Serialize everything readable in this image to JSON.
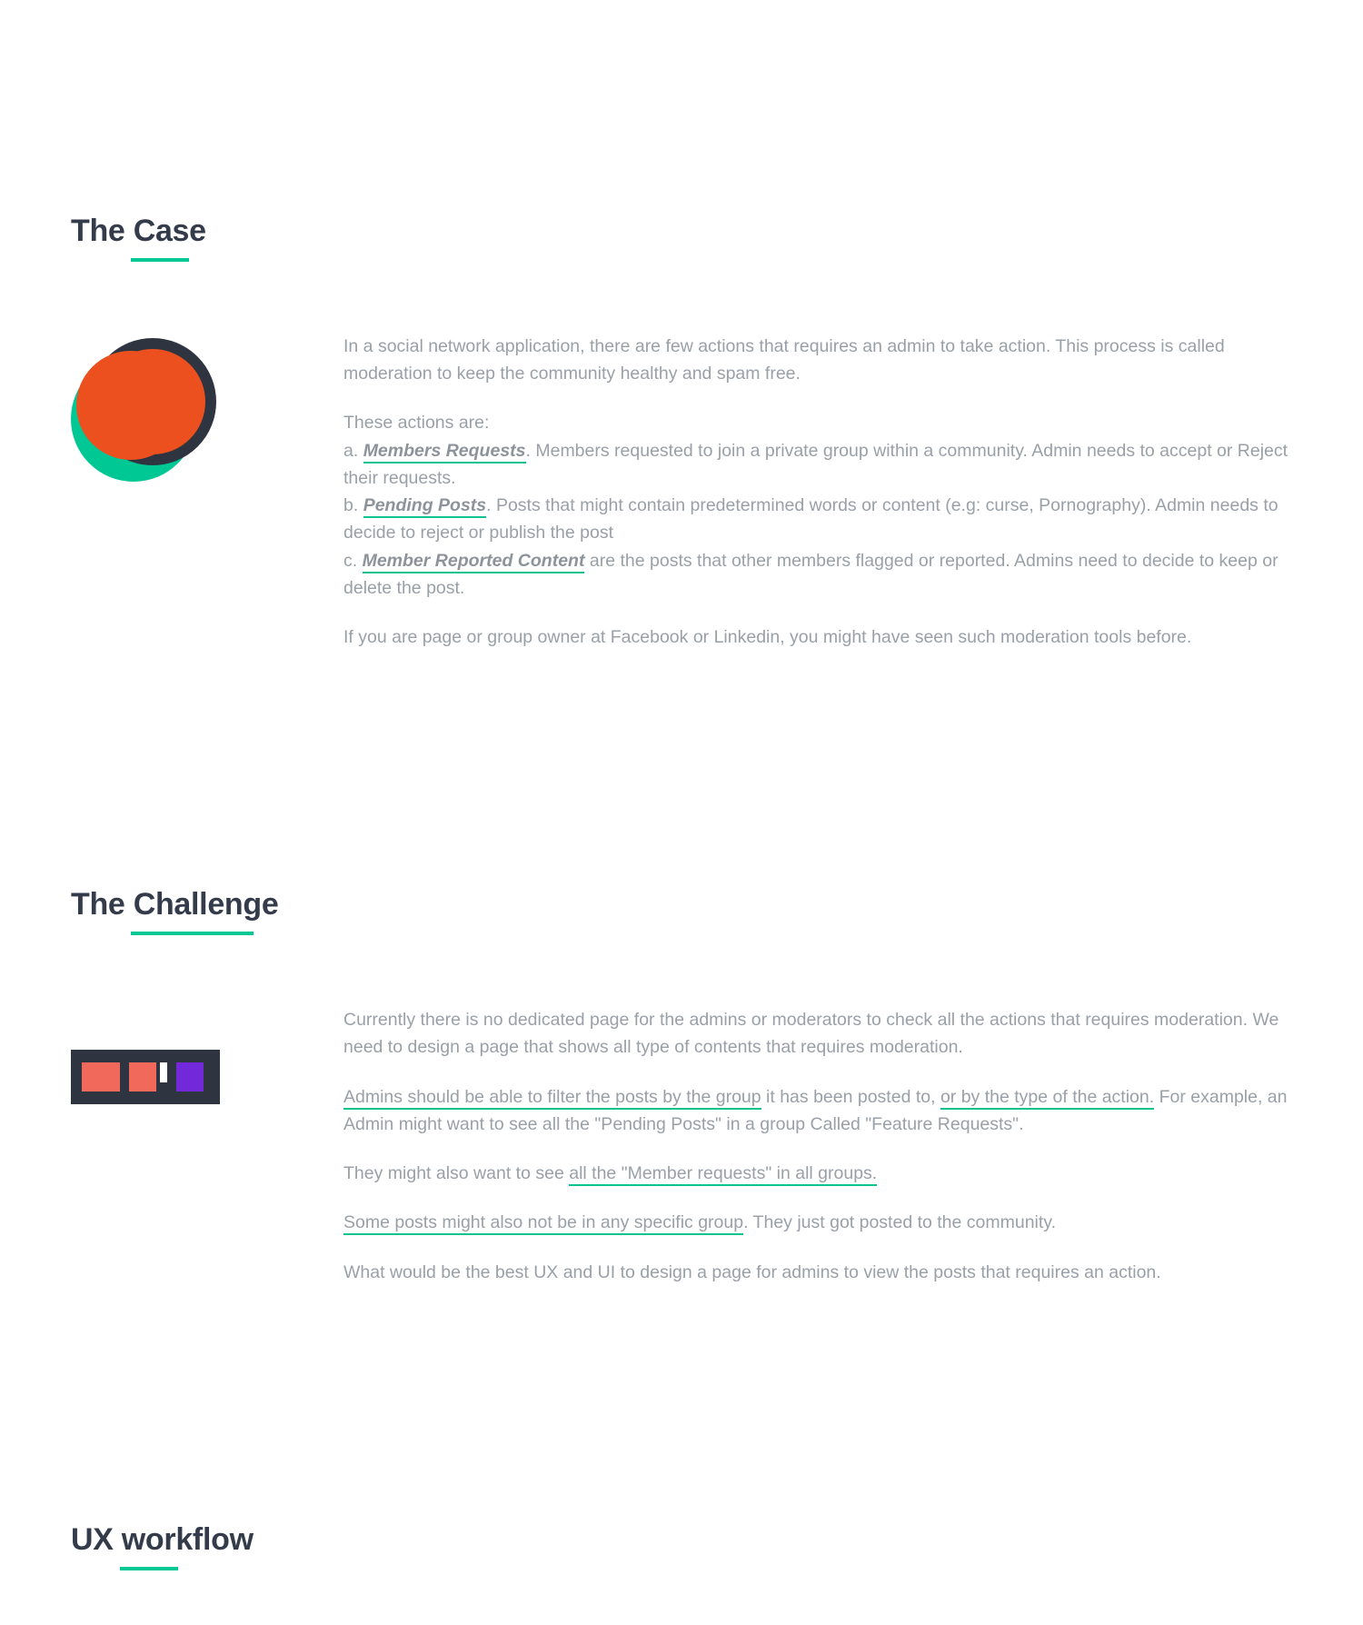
{
  "sections": {
    "case": {
      "heading": "The Case",
      "intro": "In a social network application, there are few actions that requires an admin to take action. This process is called moderation to keep the community healthy and spam free.",
      "actions_lead": "These actions are:",
      "item_a_prefix": "a.  ",
      "item_a_term": "Members Requests",
      "item_a_rest": ". Members requested to join a private group within a community. Admin needs to accept or Reject their requests.",
      "item_b_prefix": "b. ",
      "item_b_term": "Pending Posts",
      "item_b_rest": ". Posts that might contain predetermined words or content (e.g: curse, Pornography). Admin needs to decide to reject or publish the post",
      "item_c_prefix": "c.  ",
      "item_c_term": "Member Reported Content",
      "item_c_rest": " are the posts that other members flagged or reported. Admins need to decide to keep or delete the post.",
      "footer": "If you are page or group owner at Facebook or Linkedin, you might have seen such moderation tools before."
    },
    "challenge": {
      "heading": "The Challenge",
      "p1": "Currently there is no dedicated page for the admins or moderators to check all the actions that requires moderation. We need to design a page that shows all type of contents that requires moderation.",
      "p2_hl1": "Admins should be able to filter the posts by the group",
      "p2_mid1": " it has been posted to, ",
      "p2_hl2": "or by the type of the action.",
      "p2_rest": " For example, an Admin might want to see all the \"Pending Posts\" in a group Called \"Feature Requests\".",
      "p3_lead": "They might also want to see ",
      "p3_hl": "all the \"Member requests\" in all groups.",
      "p4_hl": "Some posts might also not be in any specific group",
      "p4_rest": ". They just got posted to the community.",
      "p5": "What would be the best UX and UI to design a page for admins to view the posts that requires an action."
    },
    "workflow": {
      "heading": "UX workflow"
    }
  }
}
